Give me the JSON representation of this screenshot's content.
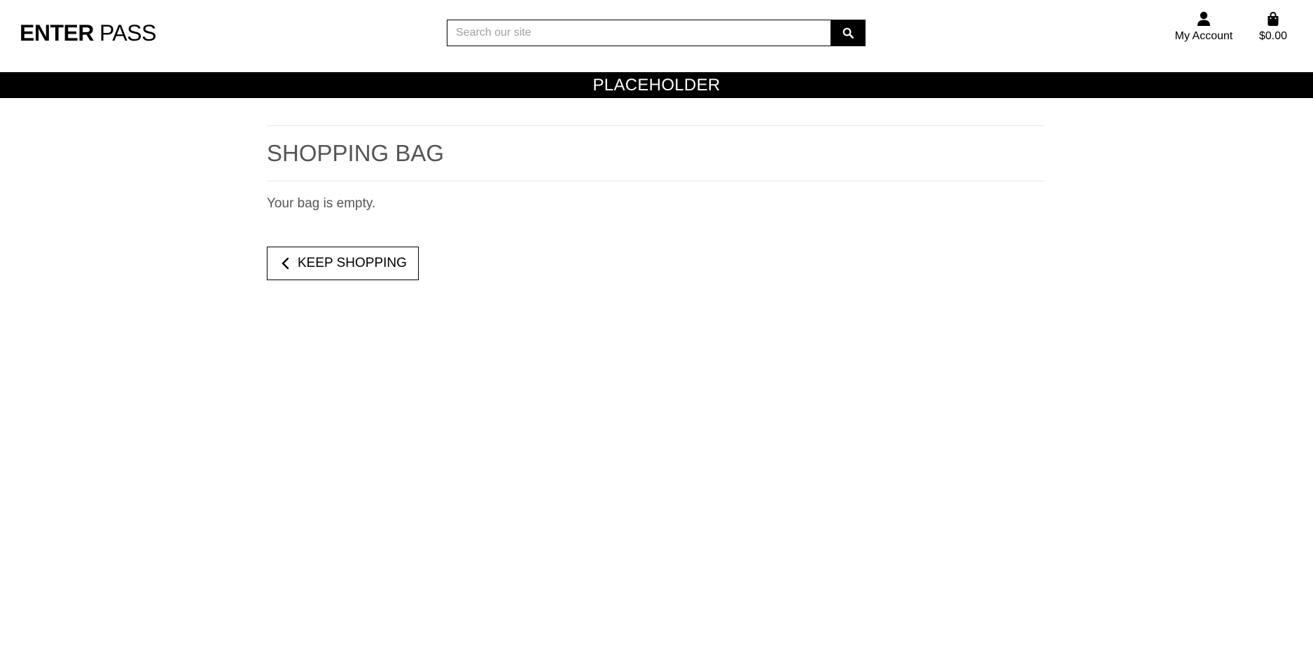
{
  "header": {
    "logo": {
      "bold_text": "ENTER",
      "light_text": "PASS"
    },
    "search": {
      "placeholder": "Search our site",
      "value": "",
      "button_icon": "search-icon"
    },
    "account": {
      "icon": "user-icon",
      "label": "My Account"
    },
    "bag": {
      "icon": "shopping-bag-icon",
      "total": "$0.00"
    }
  },
  "banner": {
    "text": "PLACEHOLDER"
  },
  "main": {
    "title": "SHOPPING BAG",
    "empty_message": "Your bag is empty.",
    "keep_shopping_label": "KEEP SHOPPING",
    "keep_shopping_icon": "chevron-left-icon"
  },
  "colors": {
    "banner_background": "#000000",
    "banner_text": "#ffffff",
    "heading_text": "#555555"
  }
}
